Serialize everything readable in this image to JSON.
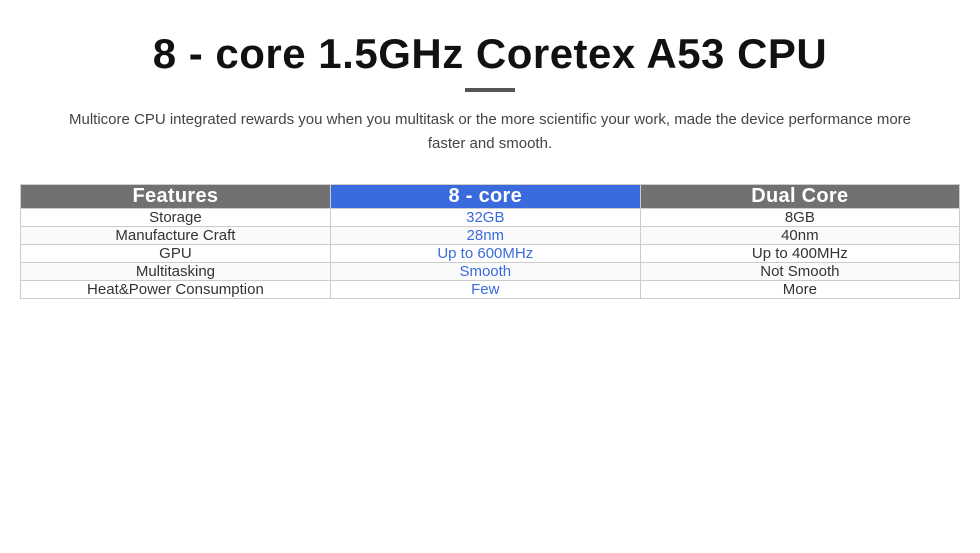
{
  "page": {
    "title": "8 - core 1.5GHz Coretex A53 CPU",
    "subtitle": "Multicore CPU integrated rewards you when you multitask or the more scientific your work, made the device performance more faster and smooth.",
    "divider_color": "#555555"
  },
  "table": {
    "headers": {
      "features": "Features",
      "col1": "8 - core",
      "col2": "Dual Core"
    },
    "rows": [
      {
        "feature": "Storage",
        "col1_value": "32GB",
        "col2_value": "8GB"
      },
      {
        "feature": "Manufacture Craft",
        "col1_value": "28nm",
        "col2_value": "40nm"
      },
      {
        "feature": "GPU",
        "col1_value": "Up to 600MHz",
        "col2_value": "Up to 400MHz"
      },
      {
        "feature": "Multitasking",
        "col1_value": "Smooth",
        "col2_value": "Not Smooth"
      },
      {
        "feature": "Heat&Power Consumption",
        "col1_value": "Few",
        "col2_value": "More"
      }
    ]
  }
}
